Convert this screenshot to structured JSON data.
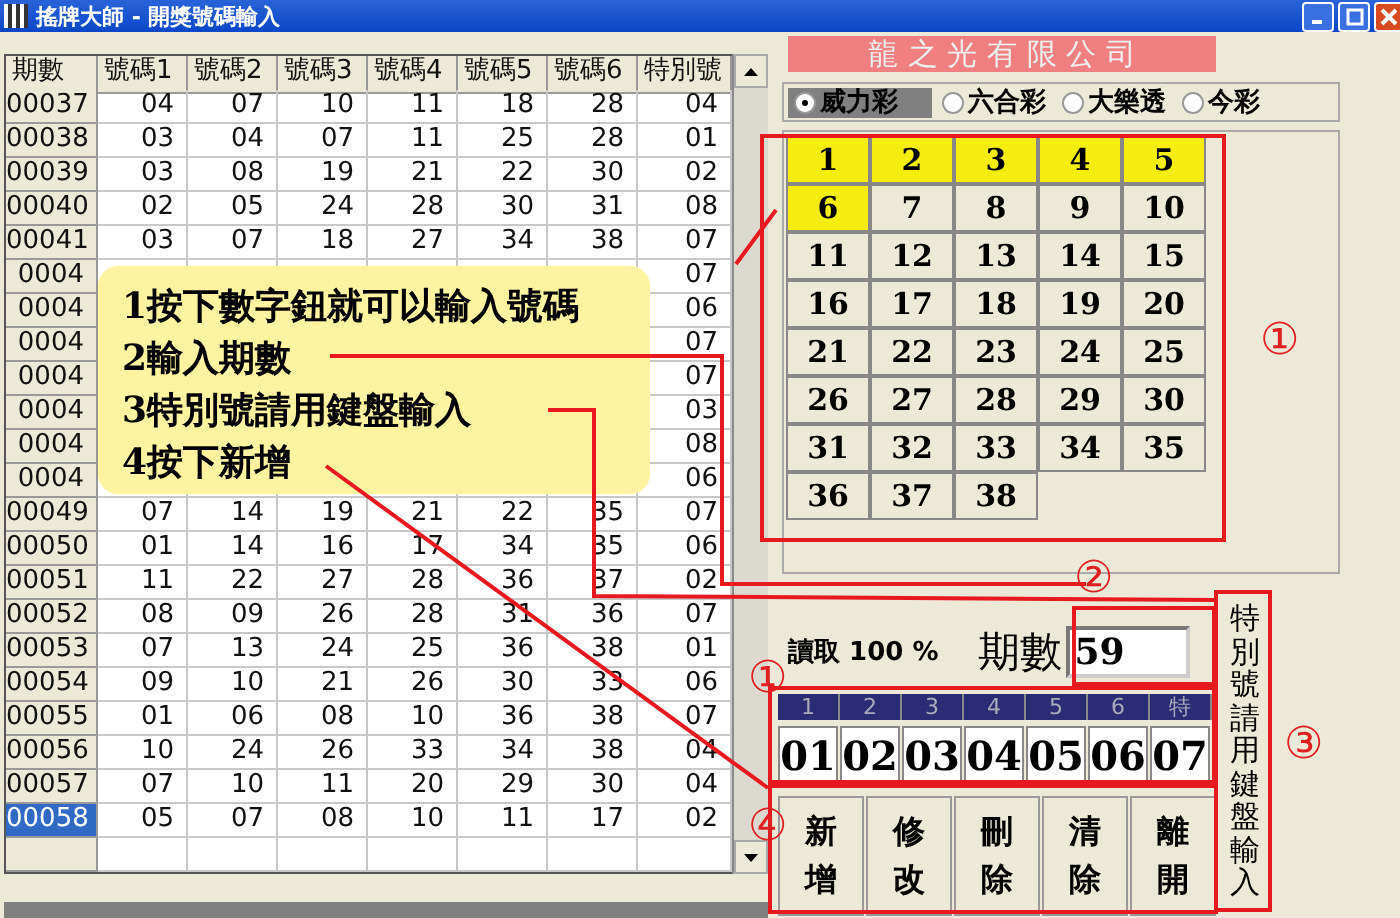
{
  "window": {
    "title": "搖牌大師 - 開獎號碼輸入"
  },
  "table": {
    "columns": [
      "期數",
      "號碼1",
      "號碼2",
      "號碼3",
      "號碼4",
      "號碼5",
      "號碼6",
      "特別號"
    ],
    "rows": [
      {
        "period": "00037",
        "numbers": [
          "04",
          "07",
          "10",
          "11",
          "18",
          "28"
        ],
        "special": "04",
        "selected": false
      },
      {
        "period": "00038",
        "numbers": [
          "03",
          "04",
          "07",
          "11",
          "25",
          "28"
        ],
        "special": "01",
        "selected": false
      },
      {
        "period": "00039",
        "numbers": [
          "03",
          "08",
          "19",
          "21",
          "22",
          "30"
        ],
        "special": "02",
        "selected": false
      },
      {
        "period": "00040",
        "numbers": [
          "02",
          "05",
          "24",
          "28",
          "30",
          "31"
        ],
        "special": "08",
        "selected": false
      },
      {
        "period": "00041",
        "numbers": [
          "03",
          "07",
          "18",
          "27",
          "34",
          "38"
        ],
        "special": "07",
        "selected": false
      },
      {
        "period": "0004",
        "special": "07",
        "selected": false
      },
      {
        "period": "0004",
        "special": "06",
        "selected": false
      },
      {
        "period": "0004",
        "special": "07",
        "selected": false
      },
      {
        "period": "0004",
        "special": "07",
        "selected": false
      },
      {
        "period": "0004",
        "special": "03",
        "selected": false
      },
      {
        "period": "0004",
        "special": "08",
        "selected": false
      },
      {
        "period": "0004",
        "special": "06",
        "selected": false
      },
      {
        "period": "00049",
        "numbers": [
          "07",
          "14",
          "19",
          "21",
          "22",
          "35"
        ],
        "special": "07",
        "selected": false
      },
      {
        "period": "00050",
        "numbers": [
          "01",
          "14",
          "16",
          "17",
          "34",
          "35"
        ],
        "special": "06",
        "selected": false
      },
      {
        "period": "00051",
        "numbers": [
          "11",
          "22",
          "27",
          "28",
          "36",
          "37"
        ],
        "special": "02",
        "selected": false
      },
      {
        "period": "00052",
        "numbers": [
          "08",
          "09",
          "26",
          "28",
          "31",
          "36"
        ],
        "special": "07",
        "selected": false
      },
      {
        "period": "00053",
        "numbers": [
          "07",
          "13",
          "24",
          "25",
          "36",
          "38"
        ],
        "special": "01",
        "selected": false
      },
      {
        "period": "00054",
        "numbers": [
          "09",
          "10",
          "21",
          "26",
          "30",
          "33"
        ],
        "special": "06",
        "selected": false
      },
      {
        "period": "00055",
        "numbers": [
          "01",
          "06",
          "08",
          "10",
          "36",
          "38"
        ],
        "special": "07",
        "selected": false
      },
      {
        "period": "00056",
        "numbers": [
          "10",
          "24",
          "26",
          "33",
          "34",
          "38"
        ],
        "special": "04",
        "selected": false
      },
      {
        "period": "00057",
        "numbers": [
          "07",
          "10",
          "11",
          "20",
          "29",
          "30"
        ],
        "special": "04",
        "selected": false
      },
      {
        "period": "00058",
        "numbers": [
          "05",
          "07",
          "08",
          "10",
          "11",
          "17"
        ],
        "special": "02",
        "selected": true
      }
    ]
  },
  "company": "龍 之 光 有 限 公 司",
  "lottery_types": [
    {
      "label": "威力彩",
      "selected": true
    },
    {
      "label": "六合彩",
      "selected": false
    },
    {
      "label": "大樂透",
      "selected": false
    },
    {
      "label": "今彩",
      "selected": false
    }
  ],
  "number_buttons": [
    {
      "label": "1",
      "selected": true
    },
    {
      "label": "2",
      "selected": true
    },
    {
      "label": "3",
      "selected": true
    },
    {
      "label": "4",
      "selected": true
    },
    {
      "label": "5",
      "selected": true
    },
    {
      "label": "6",
      "selected": true
    },
    {
      "label": "7",
      "selected": false
    },
    {
      "label": "8",
      "selected": false
    },
    {
      "label": "9",
      "selected": false
    },
    {
      "label": "10",
      "selected": false
    },
    {
      "label": "11",
      "selected": false
    },
    {
      "label": "12",
      "selected": false
    },
    {
      "label": "13",
      "selected": false
    },
    {
      "label": "14",
      "selected": false
    },
    {
      "label": "15",
      "selected": false
    },
    {
      "label": "16",
      "selected": false
    },
    {
      "label": "17",
      "selected": false
    },
    {
      "label": "18",
      "selected": false
    },
    {
      "label": "19",
      "selected": false
    },
    {
      "label": "20",
      "selected": false
    },
    {
      "label": "21",
      "selected": false
    },
    {
      "label": "22",
      "selected": false
    },
    {
      "label": "23",
      "selected": false
    },
    {
      "label": "24",
      "selected": false
    },
    {
      "label": "25",
      "selected": false
    },
    {
      "label": "26",
      "selected": false
    },
    {
      "label": "27",
      "selected": false
    },
    {
      "label": "28",
      "selected": false
    },
    {
      "label": "29",
      "selected": false
    },
    {
      "label": "30",
      "selected": false
    },
    {
      "label": "31",
      "selected": false
    },
    {
      "label": "32",
      "selected": false
    },
    {
      "label": "33",
      "selected": false
    },
    {
      "label": "34",
      "selected": false
    },
    {
      "label": "35",
      "selected": false
    },
    {
      "label": "36",
      "selected": false
    },
    {
      "label": "37",
      "selected": false
    },
    {
      "label": "38",
      "selected": false
    }
  ],
  "read_status": "讀取 100 %",
  "period_label": "期數",
  "period_input": {
    "value": "59"
  },
  "balls": [
    {
      "label": "1",
      "value": "01"
    },
    {
      "label": "2",
      "value": "02"
    },
    {
      "label": "3",
      "value": "03"
    },
    {
      "label": "4",
      "value": "04"
    },
    {
      "label": "5",
      "value": "05"
    },
    {
      "label": "6",
      "value": "06"
    },
    {
      "label": "特",
      "value": "07"
    }
  ],
  "buttons": [
    {
      "label": "新增"
    },
    {
      "label": "修改"
    },
    {
      "label": "刪除"
    },
    {
      "label": "清除"
    },
    {
      "label": "離開"
    }
  ],
  "vertical_note": "特別號請用鍵盤輸入",
  "callout": {
    "lines": [
      "1按下數字鈕就可以輸入號碼",
      "2輸入期數",
      "3特別號請用鍵盤輸入",
      "4按下新增"
    ]
  },
  "markers": [
    "①",
    "②",
    "①",
    "③",
    "④"
  ]
}
